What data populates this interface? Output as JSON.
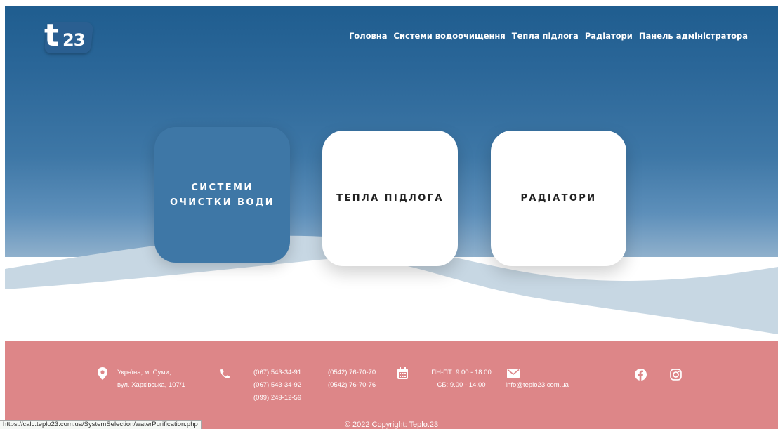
{
  "logo": {
    "t": "t",
    "number": "23"
  },
  "nav": [
    {
      "label": "Головна"
    },
    {
      "label": "Системи водоочищення"
    },
    {
      "label": "Тепла підлога"
    },
    {
      "label": "Радіатори"
    },
    {
      "label": "Панель адміністратора"
    }
  ],
  "cards": [
    {
      "label": "СИСТЕМИ ОЧИСТКИ ВОДИ",
      "state": "hovered"
    },
    {
      "label": "ТЕПЛА ПІДЛОГА"
    },
    {
      "label": "РАДІАТОРИ"
    }
  ],
  "footer": {
    "address_line1": "Україна, м. Суми,",
    "address_line2": "вул. Харківська, 107/1",
    "phones_col1": [
      "(067) 543-34-91",
      "(067) 543-34-92",
      "(099) 249-12-59"
    ],
    "phones_col2": [
      "(0542) 76-70-70",
      "(0542) 76-70-76"
    ],
    "hours_line1": "ПН-ПТ: 9.00 - 18.00",
    "hours_line2": "СБ: 9.00 - 14.00",
    "email": "info@teplo23.com.ua",
    "copyright": "© 2022 Copyright: Teplo.23",
    "icons": {
      "location": "map-marker-icon",
      "phone": "phone-icon",
      "calendar": "calendar-icon",
      "email": "envelope-icon",
      "facebook": "facebook-icon",
      "instagram": "instagram-icon"
    }
  },
  "status_bar": {
    "url": "https://calc.teplo23.com.ua/SystemSelection/waterPurification.php"
  },
  "colors": {
    "hero_top": "#1f5d8f",
    "card_active": "#3e77a6",
    "footer_bg": "#dd8688"
  }
}
